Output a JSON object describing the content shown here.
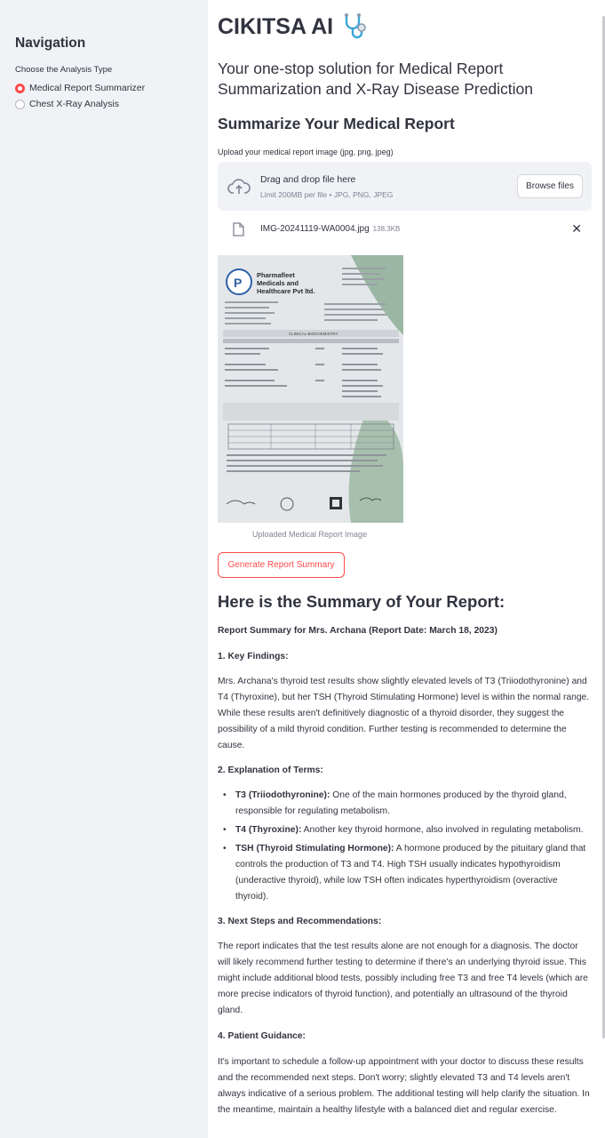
{
  "sidebar": {
    "title": "Navigation",
    "radio_caption": "Choose the Analysis Type",
    "options": [
      {
        "label": "Medical Report Summarizer",
        "selected": true
      },
      {
        "label": "Chest X-Ray Analysis",
        "selected": false
      }
    ]
  },
  "header": {
    "title": "CIKITSA AI",
    "icon": "stethoscope-icon",
    "subtitle": "Your one-stop solution for Medical Report Summarization and X-Ray Disease Prediction"
  },
  "upload": {
    "section_title": "Summarize Your Medical Report",
    "caption": "Upload your medical report image (jpg, png, jpeg)",
    "dropzone_title": "Drag and drop file here",
    "dropzone_limit": "Limit 200MB per file • JPG, PNG, JPEG",
    "browse_label": "Browse files",
    "file_name": "IMG-20241119-WA0004.jpg",
    "file_size": "138.3KB",
    "image_caption": "Uploaded Medical Report Image"
  },
  "report_image": {
    "company": "Pharmafleet Medicals and Healthcare Pvt ltd.",
    "section": "CLINICAL BIOCHEMISTRY"
  },
  "generate_button": "Generate Report Summary",
  "summary": {
    "heading": "Here is the Summary of Your Report:",
    "report_line": "Report Summary for Mrs. Archana (Report Date: March 18, 2023)",
    "key_findings_title": "1. Key Findings:",
    "key_findings_text": "Mrs. Archana's thyroid test results show slightly elevated levels of T3 (Triiodothyronine) and T4 (Thyroxine), but her TSH (Thyroid Stimulating Hormone) level is within the normal range. While these results aren't definitively diagnostic of a thyroid disorder, they suggest the possibility of a mild thyroid condition. Further testing is recommended to determine the cause.",
    "terms_title": "2. Explanation of Terms:",
    "terms": [
      {
        "term": "T3 (Triiodothyronine):",
        "def": "One of the main hormones produced by the thyroid gland, responsible for regulating metabolism."
      },
      {
        "term": "T4 (Thyroxine):",
        "def": "Another key thyroid hormone, also involved in regulating metabolism."
      },
      {
        "term": "TSH (Thyroid Stimulating Hormone):",
        "def": "A hormone produced by the pituitary gland that controls the production of T3 and T4. High TSH usually indicates hypothyroidism (underactive thyroid), while low TSH often indicates hyperthyroidism (overactive thyroid)."
      }
    ],
    "next_steps_title": "3. Next Steps and Recommendations:",
    "next_steps_text": "The report indicates that the test results alone are not enough for a diagnosis. The doctor will likely recommend further testing to determine if there's an underlying thyroid issue. This might include additional blood tests, possibly including free T3 and free T4 levels (which are more precise indicators of thyroid function), and potentially an ultrasound of the thyroid gland.",
    "guidance_title": "4. Patient Guidance:",
    "guidance_text": "It's important to schedule a follow-up appointment with your doctor to discuss these results and the recommended next steps. Don't worry; slightly elevated T3 and T4 levels aren't always indicative of a serious problem. The additional testing will help clarify the situation. In the meantime, maintain a healthy lifestyle with a balanced diet and regular exercise."
  },
  "colors": {
    "accent": "#ff4b4b",
    "sidebar_bg": "#f0f2f6",
    "text": "#31333f"
  }
}
